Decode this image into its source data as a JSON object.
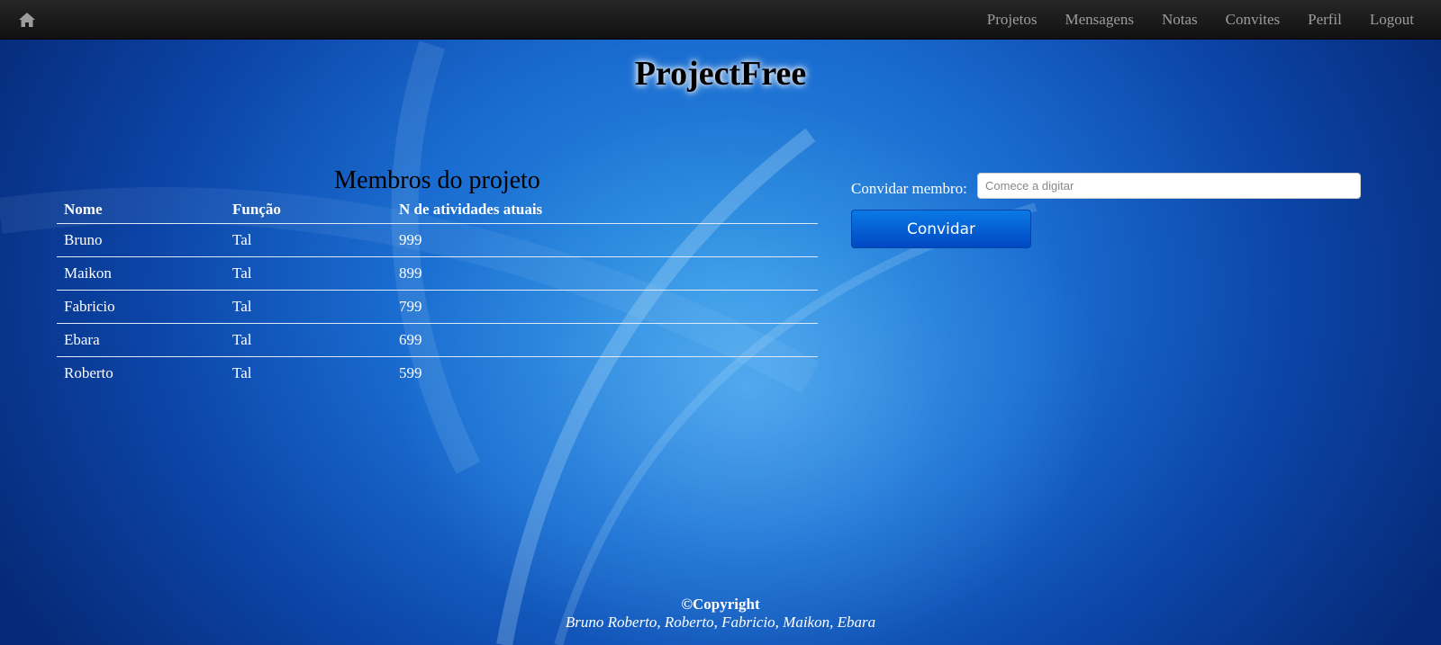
{
  "navbar": {
    "home_icon": "home-icon",
    "links": [
      "Projetos",
      "Mensagens",
      "Notas",
      "Convites",
      "Perfil",
      "Logout"
    ]
  },
  "site_title": "ProjectFree",
  "members": {
    "heading": "Membros do projeto",
    "columns": [
      "Nome",
      "Função",
      "N de atividades atuais"
    ],
    "rows": [
      [
        "Bruno",
        "Tal",
        "999"
      ],
      [
        "Maikon",
        "Tal",
        "899"
      ],
      [
        "Fabricio",
        "Tal",
        "799"
      ],
      [
        "Ebara",
        "Tal",
        "699"
      ],
      [
        "Roberto",
        "Tal",
        "599"
      ]
    ]
  },
  "invite": {
    "label": "Convidar membro:",
    "placeholder": "Comece a digitar",
    "value": "",
    "button_label": "Convidar"
  },
  "footer": {
    "copyright": "©Copyright",
    "names": "Bruno Roberto, Roberto, Fabricio, Maikon, Ebara"
  },
  "colors": {
    "navbar_bg": "#1b1b1b",
    "nav_link": "#9d9d9d",
    "button_bg": "#0a6ad8",
    "background": "#1a6cd0"
  }
}
